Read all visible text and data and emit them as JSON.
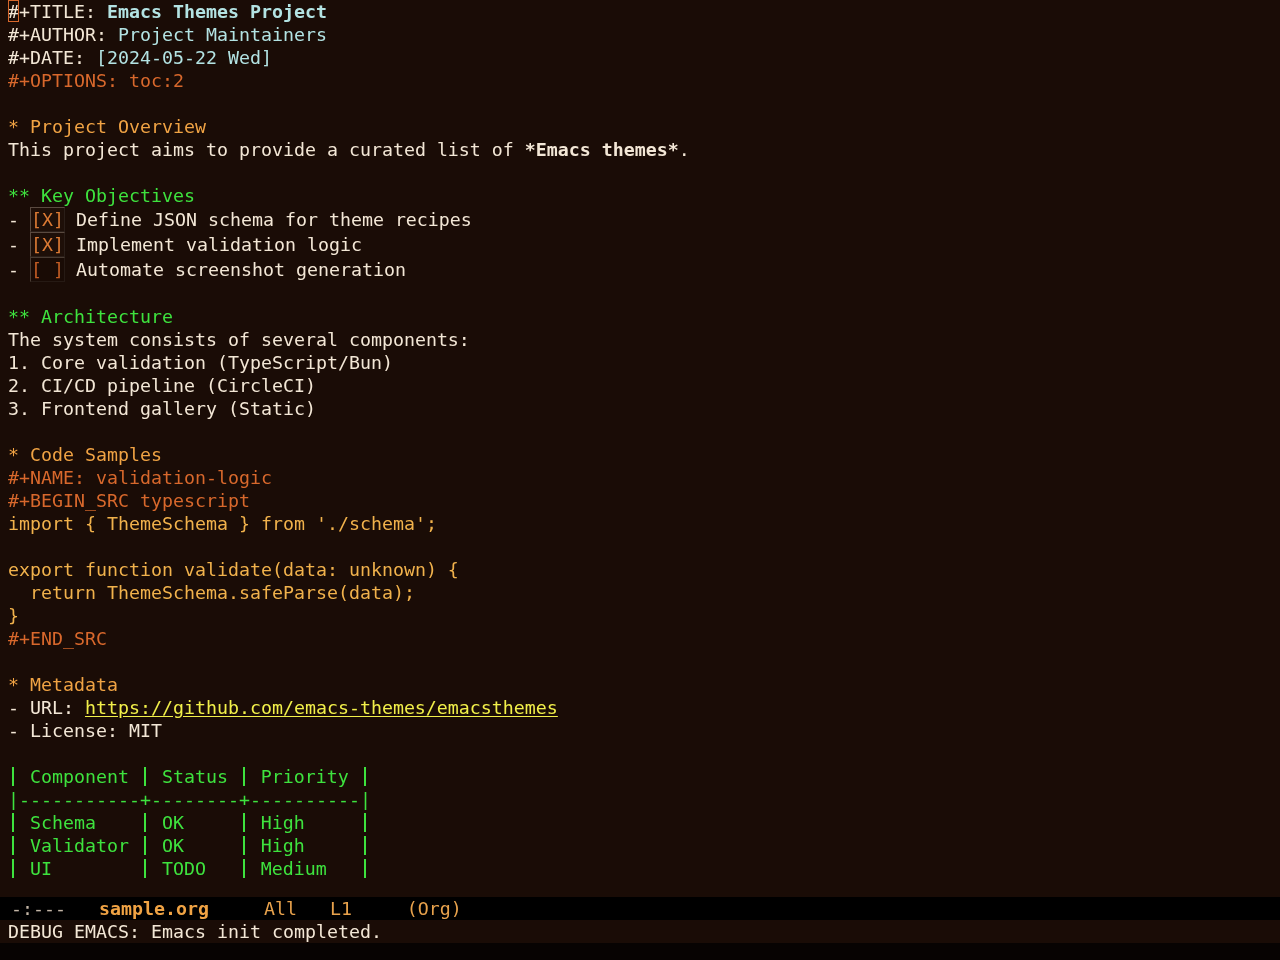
{
  "buffer": {
    "keywords": [
      {
        "kind": "title",
        "key": "#+TITLE:",
        "value": "Emacs Themes Project",
        "cursor": true
      },
      {
        "kind": "info",
        "key": "#+AUTHOR:",
        "value": "Project Maintainers",
        "cursor": false
      },
      {
        "kind": "info",
        "key": "#+DATE:",
        "value": "[2024-05-22 Wed]",
        "cursor": false
      },
      {
        "kind": "option",
        "key": "#+OPTIONS:",
        "value": "toc:2",
        "cursor": false
      }
    ],
    "sections": [
      {
        "stars": "*",
        "title": "Project Overview",
        "blocks": [
          {
            "kind": "paragraph",
            "runs": [
              {
                "kind": "plain",
                "text": "This project aims to provide a curated list of "
              },
              {
                "kind": "bold",
                "text": "*Emacs themes*"
              },
              {
                "kind": "plain",
                "text": "."
              }
            ]
          }
        ],
        "children": [
          {
            "stars": "**",
            "title": "Key Objectives",
            "blocks": [
              {
                "kind": "checklist",
                "items": [
                  {
                    "bullet": "-",
                    "box": "[X]",
                    "checked": true,
                    "text": "Define JSON schema for theme recipes"
                  },
                  {
                    "bullet": "-",
                    "box": "[X]",
                    "checked": true,
                    "text": "Implement validation logic"
                  },
                  {
                    "bullet": "-",
                    "box": "[ ]",
                    "checked": false,
                    "text": "Automate screenshot generation"
                  }
                ]
              }
            ]
          },
          {
            "stars": "**",
            "title": "Architecture",
            "blocks": [
              {
                "kind": "list",
                "lead": "The system consists of several components:",
                "items": [
                  {
                    "marker": "1.",
                    "text": "Core validation (TypeScript/Bun)"
                  },
                  {
                    "marker": "2.",
                    "text": "CI/CD pipeline (CircleCI)"
                  },
                  {
                    "marker": "3.",
                    "text": "Frontend gallery (Static)"
                  }
                ]
              }
            ]
          }
        ]
      },
      {
        "stars": "*",
        "title": "Code Samples",
        "blocks": [
          {
            "kind": "source",
            "name_line": "#+NAME: validation-logic",
            "begin_line": "#+BEGIN_SRC typescript",
            "code": "import { ThemeSchema } from './schema';\n\nexport function validate(data: unknown) {\n  return ThemeSchema.safeParse(data);\n}",
            "end_line": "#+END_SRC"
          }
        ]
      },
      {
        "stars": "*",
        "title": "Metadata",
        "blocks": [
          {
            "kind": "fields",
            "items": [
              {
                "bullet": "-",
                "label": "URL:",
                "value": "https://github.com/emacs-themes/emacsthemes",
                "link": true
              },
              {
                "bullet": "-",
                "label": "License:",
                "value": "MIT",
                "link": false
              }
            ]
          },
          {
            "kind": "table",
            "columns": [
              "Component",
              "Status",
              "Priority"
            ],
            "rule": "|-----------+--------+----------|",
            "rows": [
              [
                "Schema",
                "OK",
                "High"
              ],
              [
                "Validator",
                "OK",
                "High"
              ],
              [
                "UI",
                "TODO",
                "Medium"
              ]
            ]
          }
        ]
      }
    ]
  },
  "mode_line": {
    "status": "-:---",
    "buffer_name": "sample.org",
    "position": "All",
    "line": "L1",
    "mode": "(Org)"
  },
  "echo_area": {
    "message": "DEBUG EMACS: Emacs init completed."
  }
}
